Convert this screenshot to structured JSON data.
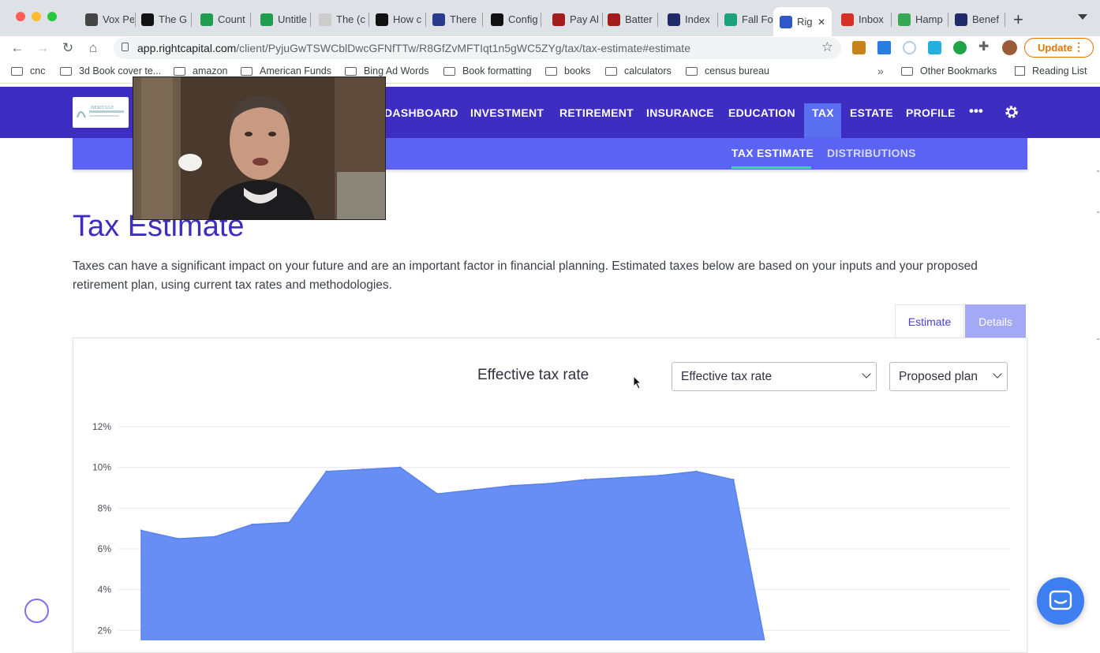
{
  "browser": {
    "tabs": [
      {
        "label": "Vox Pe",
        "fav_color": "#444"
      },
      {
        "label": "The G",
        "fav_color": "#111"
      },
      {
        "label": "Count",
        "fav_color": "#1e9e4e"
      },
      {
        "label": "Untitle",
        "fav_color": "#1e9e4e"
      },
      {
        "label": "The (c",
        "fav_color": "#ccc"
      },
      {
        "label": "How c",
        "fav_color": "#111"
      },
      {
        "label": "There",
        "fav_color": "#2a3b8f"
      },
      {
        "label": "Config",
        "fav_color": "#111"
      },
      {
        "label": "Pay Al",
        "fav_color": "#a21c1c"
      },
      {
        "label": "Batter",
        "fav_color": "#a21c1c"
      },
      {
        "label": "Index",
        "fav_color": "#1f2a6b"
      },
      {
        "label": "Fall Fo",
        "fav_color": "#1aa37a"
      },
      {
        "label": "Rig",
        "fav_color": "#3058c8"
      },
      {
        "label": "Inbox",
        "fav_color": "#d93025"
      },
      {
        "label": "Hamp",
        "fav_color": "#34a853"
      },
      {
        "label": "Benef",
        "fav_color": "#1f2a6b"
      }
    ],
    "active_tab_index": 12,
    "url_host": "app.rightcapital.com",
    "url_path": "/client/PyjuGwTSWCblDwcGFNfTTw/R8GfZvMFTIqt1n5gWC5ZYg/tax/tax-estimate#estimate",
    "update_label": "Update",
    "bookmarks": [
      "cnc",
      "3d Book cover te...",
      "amazon",
      "American Funds",
      "Bing Ad Words",
      "Book formatting",
      "books",
      "calculators",
      "census bureau"
    ],
    "bookmarks_overflow": "»",
    "other_bookmarks": "Other Bookmarks",
    "reading_list": "Reading List"
  },
  "app": {
    "logo_text": "HERITAGE",
    "nav": [
      "DASHBOARD",
      "INVESTMENT",
      "RETIREMENT",
      "INSURANCE",
      "EDUCATION",
      "TAX",
      "ESTATE",
      "PROFILE"
    ],
    "nav_active": "TAX",
    "more": "•••",
    "subnav": [
      "TAX ESTIMATE",
      "DISTRIBUTIONS"
    ],
    "subnav_active": "TAX ESTIMATE"
  },
  "content": {
    "title": "Tax Estimate",
    "intro": "Taxes can have a significant impact on your future and are an important factor in financial planning. Estimated taxes below are based on your inputs and your proposed retirement plan, using current tax rates and methodologies.",
    "toggle": {
      "estimate": "Estimate",
      "details": "Details",
      "active": "Estimate"
    },
    "chart_heading": "Effective tax rate",
    "metric_select": "Effective tax rate",
    "plan_select": "Proposed plan"
  },
  "colors": {
    "brand": "#3d2dc0",
    "subnav": "#5b63f2",
    "active_underline": "#47d1a5",
    "area_fill": "#668ef5"
  },
  "chart_data": {
    "type": "area",
    "title": "Effective tax rate",
    "xlabel": "",
    "ylabel": "",
    "y_ticks": [
      "12%",
      "10%",
      "8%",
      "6%",
      "4%",
      "2%"
    ],
    "ylim": [
      0,
      12
    ],
    "y_unit": "%",
    "grid": true,
    "series": [
      {
        "values": [
          6.9,
          6.5,
          6.6,
          7.2,
          7.3,
          9.8,
          9.9,
          10.0,
          8.7,
          8.9,
          9.1,
          9.2,
          9.4,
          9.5,
          9.6,
          9.8,
          9.4,
          0.0
        ]
      }
    ]
  }
}
